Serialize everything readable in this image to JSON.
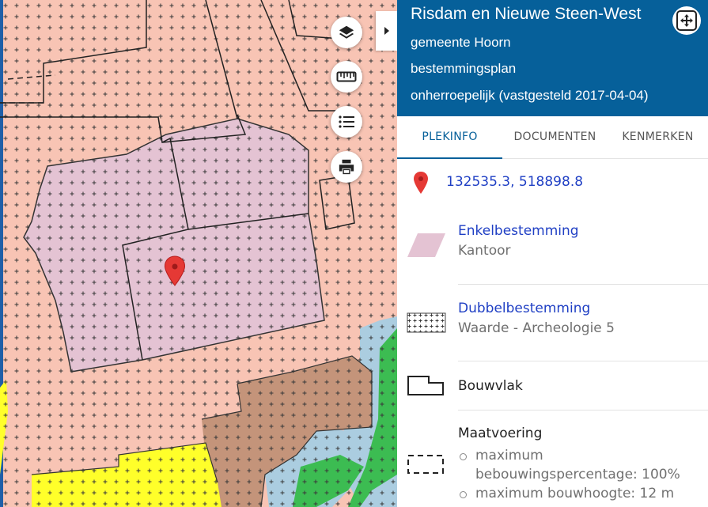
{
  "map": {
    "layers_icon": "layers-icon",
    "measure_icon": "ruler-icon",
    "legend_icon": "list-icon",
    "print_icon": "printer-icon",
    "collapse_icon": "chevron-right-icon",
    "marker_icon": "map-marker-icon",
    "colors": {
      "base": "#f8c4b4",
      "kantoor": "#e4c3d3",
      "brown": "#c4947a",
      "yellow": "#ffff2a",
      "green": "#3cbc52",
      "blue": "#abcde0",
      "grey": "#d4d4d4"
    }
  },
  "header": {
    "title": "Risdam en Nieuwe Steen-West",
    "municipality": "gemeente Hoorn",
    "plan_type": "bestemmingsplan",
    "status": "onherroepelijk (vastgesteld 2017-04-04)",
    "expand_icon": "expand-arrows-icon",
    "color": "#06609a"
  },
  "tabs": [
    {
      "label": "PLEKINFO",
      "active": true
    },
    {
      "label": "DOCUMENTEN",
      "active": false
    },
    {
      "label": "KENMERKEN",
      "active": false
    }
  ],
  "location": {
    "coordinates": "132535.3, 518898.8",
    "icon": "location-pin-icon"
  },
  "items": {
    "enkel": {
      "title": "Enkelbestemming",
      "value": "Kantoor"
    },
    "dubbel": {
      "title": "Dubbelbestemming",
      "value": "Waarde - Archeologie 5"
    },
    "bouwvlak": {
      "title": "Bouwvlak"
    },
    "maat": {
      "title": "Maatvoering",
      "values": [
        "maximum bebouwingspercentage: 100%",
        "maximum bouwhoogte: 12 m"
      ]
    }
  }
}
